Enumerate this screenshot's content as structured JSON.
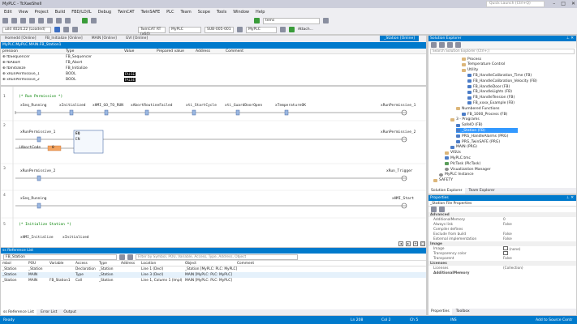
{
  "window": {
    "title": "MyPLC - TcXaeShell",
    "quick_launch": "Quick Launch (Ctrl+Q)"
  },
  "menu": [
    "Edit",
    "View",
    "Project",
    "Build",
    "FBD/LD/IL",
    "Debug",
    "TwinCAT",
    "TwinSAFE",
    "PLC",
    "Team",
    "Scope",
    "Tools",
    "Window",
    "Help"
  ],
  "toolbar": {
    "search_combo": "tems",
    "build_combo": "uild 4024.22 (Loaded)",
    "plc_combo1": "MyPLC",
    "sub_combo": "SUB-005-001",
    "plc_combo2": "MyPLC",
    "attach_label": "Attach...",
    "twincat_label": "TwinCAT RT (x64)"
  },
  "doc_tabs": [
    {
      "label": "Homedd [Online]",
      "active": false
    },
    {
      "label": "FB_Initialize [Online]",
      "active": false
    },
    {
      "label": "MAIN [Online]",
      "active": false
    },
    {
      "label": "GVI [Online]",
      "active": false
    }
  ],
  "active_tab": "_Station [Online]",
  "path": "MyPLC.MyPLC.MAIN.FB_Station1",
  "var_table": {
    "headers": [
      "pression",
      "Type",
      "Value",
      "Prepared value",
      "Address",
      "Comment"
    ],
    "rows": [
      {
        "name": "fbSequencer",
        "type": "FB_Sequencer",
        "value": ""
      },
      {
        "name": "fbAbort",
        "type": "FB_Abort",
        "value": ""
      },
      {
        "name": "fbInitialize",
        "type": "FB_Initialize",
        "value": ""
      },
      {
        "name": "xRunPermissive_1",
        "type": "BOOL",
        "value": "FALSE"
      },
      {
        "name": "xRunPermissive_2",
        "type": "BOOL",
        "value": "FALSE"
      }
    ]
  },
  "ladder": {
    "rung1_comment": "(* Run Permissive *)",
    "rung1_contacts": [
      "xSeq_Running",
      "xInitialized",
      "xHMI_GO_TO_RUN",
      "xAbortRoutineFailed",
      "xti_StartCycle",
      "xti_GuardDoorOpen",
      "xTemperatureOK"
    ],
    "rung1_coil": "xRunPermissive_1",
    "rung2_input": "xRunPermissive_1",
    "rung2_var": "iAbortCode",
    "rung2_value": "0",
    "rung2_block": "EQ",
    "rung2_in": "EN",
    "rung2_coil": "xRunPermissive_2",
    "rung3_contact": "xRunPermissive_2",
    "rung3_coil": "xRun_Trigger",
    "rung4_contact": "xSeq_Running",
    "rung4_coil": "xHMI_Start",
    "rung5_comment": "(* Initialize Station *)",
    "rung5_contacts": [
      "xHMI_Initialize",
      "xInitialized"
    ],
    "rung_numbers": [
      "1",
      "2",
      "3",
      "4",
      "5"
    ]
  },
  "xref": {
    "title": "ss Reference List",
    "search_value": "FB_Station",
    "filter_placeholder": "Filter by Symbol, POU, Variable, Access, Type, Address, Object",
    "headers": [
      "mbol",
      "POU",
      "Variable",
      "Access",
      "Type",
      "Address",
      "Location",
      "Object",
      "Comment"
    ],
    "rows": [
      {
        "symbol": "_Station",
        "pou": "_Station",
        "variable": "",
        "access": "Declaration",
        "type": "_Station",
        "address": "",
        "location": "Line 1 (Decl)",
        "object": "_Station [MyPLC: PLC: MyPLC]",
        "selected": false
      },
      {
        "symbol": "_Station",
        "pou": "MAIN",
        "variable": "",
        "access": "Type",
        "type": "_Station",
        "address": "",
        "location": "Line 3 (Decl)",
        "object": "MAIN [MyPLC: PLC: MyPLC]",
        "selected": true
      },
      {
        "symbol": "_Station",
        "pou": "MAIN",
        "variable": "FB_Station1",
        "access": "Call",
        "type": "_Station",
        "address": "",
        "location": "Line 1, Column 1 (Impl)",
        "object": "MAIN [MyPLC: PLC: MyPLC]",
        "selected": false
      }
    ],
    "tabs": [
      "ss Reference List",
      "Error List",
      "Output"
    ]
  },
  "status": {
    "left": "Ready",
    "ln": "Ln 208",
    "col": "Col 2",
    "ch": "Ch 5",
    "mode": "INS",
    "source_control": "Add to Source Contr"
  },
  "solution_explorer": {
    "title": "Solution Explorer",
    "search_placeholder": "Search Solution Explorer (Ctrl+;)",
    "items": [
      {
        "label": "Process",
        "icon": "folder",
        "indent": 5
      },
      {
        "label": "Temperature Control",
        "icon": "folder",
        "indent": 5
      },
      {
        "label": "Utility",
        "icon": "folder",
        "indent": 5
      },
      {
        "label": "FB_HandleCalibration_Time (FB)",
        "icon": "pou",
        "indent": 6
      },
      {
        "label": "FB_HandleCalibration_Velocity (FB)",
        "icon": "pou",
        "indent": 6
      },
      {
        "label": "FB_HandleDoor (FB)",
        "icon": "pou",
        "indent": 6
      },
      {
        "label": "FB_HandleLights (FB)",
        "icon": "pou",
        "indent": 6
      },
      {
        "label": "FB_HandleTension (FB)",
        "icon": "pou",
        "indent": 6
      },
      {
        "label": "FB_xxxx_Example (FB)",
        "icon": "pou",
        "indent": 6
      },
      {
        "label": "Numbered Functions",
        "icon": "folder",
        "indent": 4
      },
      {
        "label": "FB_1000_Process (FB)",
        "icon": "pou",
        "indent": 5
      },
      {
        "label": "3 - Programs",
        "icon": "folder",
        "indent": 3
      },
      {
        "label": "SafeIO (FB)",
        "icon": "pou",
        "indent": 4
      },
      {
        "label": "_Station (FB)",
        "icon": "pou",
        "indent": 4,
        "selected": true
      },
      {
        "label": "PRG_HandleAlarms (PRG)",
        "icon": "pou",
        "indent": 4
      },
      {
        "label": "PRG_TwinSAFE (PRG)",
        "icon": "pou",
        "indent": 4
      },
      {
        "label": "MAIN (PRG)",
        "icon": "pou",
        "indent": 3
      },
      {
        "label": "VISUs",
        "icon": "folder",
        "indent": 2
      },
      {
        "label": "MyPLC.tmc",
        "icon": "pou",
        "indent": 2
      },
      {
        "label": "PlcTask (PlcTask)",
        "icon": "task",
        "indent": 2
      },
      {
        "label": "Visualization Manager",
        "icon": "gear",
        "indent": 2
      },
      {
        "label": "MyPLC Instance",
        "icon": "gear",
        "indent": 1
      },
      {
        "label": "SAFETY",
        "icon": "folder",
        "indent": 0
      }
    ],
    "tabs": [
      "Solution Explorer",
      "Team Explorer"
    ]
  },
  "properties": {
    "title": "Properties",
    "object": "_Station  File Properties",
    "rows": [
      {
        "kind": "cat",
        "key": "Advanced",
        "value": ""
      },
      {
        "kind": "row",
        "key": "AdditionalMemory",
        "value": "0"
      },
      {
        "kind": "row",
        "key": "Always link",
        "value": "False"
      },
      {
        "kind": "row",
        "key": "Compiler defines",
        "value": ""
      },
      {
        "kind": "row",
        "key": "Exclude from build",
        "value": "False"
      },
      {
        "kind": "row",
        "key": "External implementation",
        "value": "False"
      },
      {
        "kind": "cat",
        "key": "Image",
        "value": ""
      },
      {
        "kind": "row",
        "key": "Image",
        "value": "(none)",
        "checkbox": true
      },
      {
        "kind": "row",
        "key": "Transparency color",
        "value": "",
        "checkbox": true
      },
      {
        "kind": "row",
        "key": "Transparent",
        "value": "False"
      },
      {
        "kind": "cat",
        "key": "Licenses",
        "value": ""
      },
      {
        "kind": "row",
        "key": "Licenses",
        "value": "(Collection)"
      },
      {
        "kind": "row",
        "key": "AdditionalMemory",
        "value": "",
        "bold": true
      }
    ],
    "tabs": [
      "Properties",
      "Toolbox"
    ]
  },
  "colors": {
    "accent": "#007acc",
    "selection": "#3399ff",
    "comment": "#008000"
  }
}
